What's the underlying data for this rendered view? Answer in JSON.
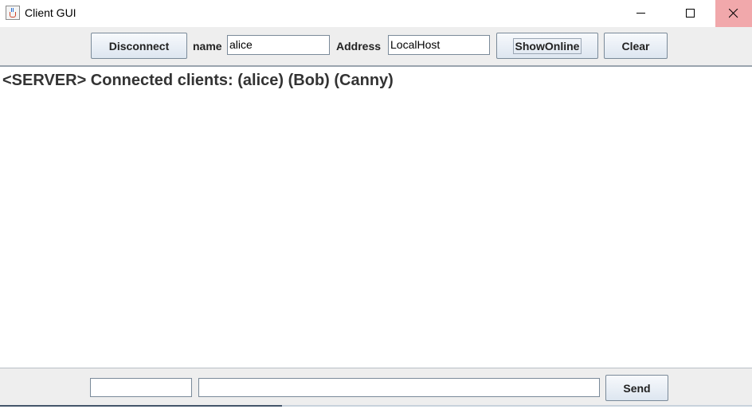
{
  "window": {
    "title": "Client GUI",
    "icon": "java-cup-icon",
    "controls": [
      "minimize-icon",
      "maximize-icon",
      "close-icon"
    ],
    "close_hover_color": "#f1a8ab"
  },
  "toolbar": {
    "disconnect_label": "Disconnect",
    "name_label": "name",
    "name_value": "alice",
    "address_label": "Address",
    "address_value": "LocalHost",
    "show_online_label": "ShowOnline",
    "clear_label": "Clear"
  },
  "chat": {
    "messages": [
      "<SERVER> Connected clients: (alice) (Bob) (Canny)"
    ]
  },
  "bottom": {
    "recipient_value": "",
    "message_value": "",
    "send_label": "Send"
  }
}
